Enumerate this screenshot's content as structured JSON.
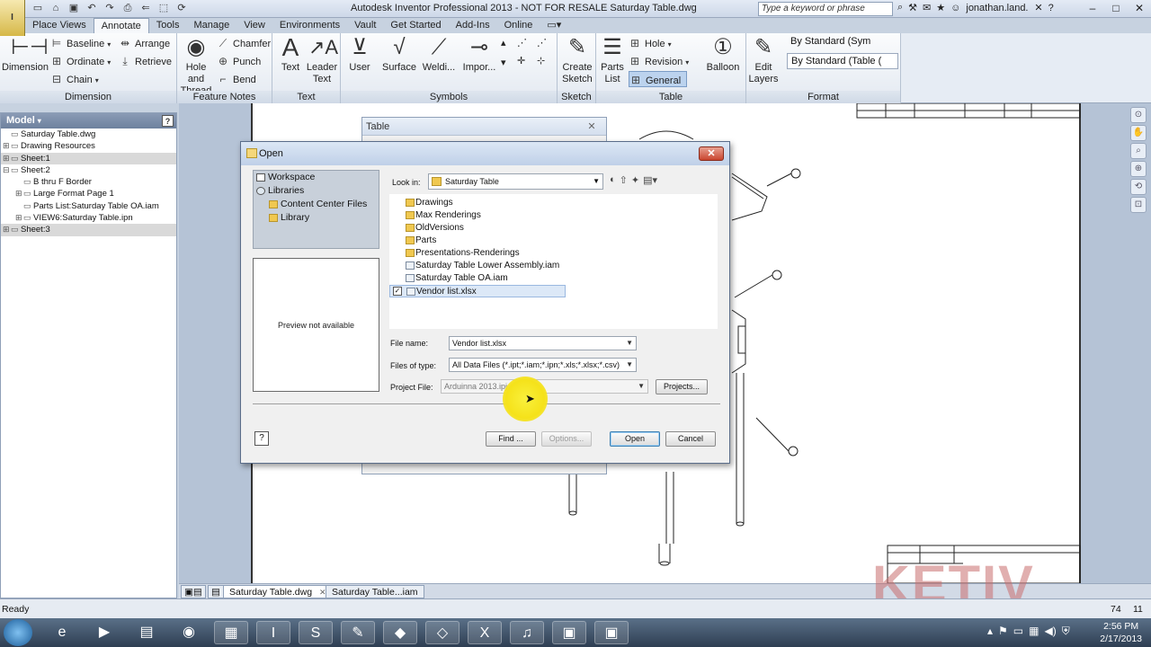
{
  "titlebar": {
    "app_logo": "I",
    "title": "Autodesk Inventor Professional 2013 - NOT FOR RESALE   Saturday Table.dwg",
    "search_placeholder": "Type a keyword or phrase",
    "user": "jonathan.land...",
    "qat_icons": [
      "new-icon",
      "open-icon",
      "save-icon",
      "undo-icon",
      "redo-icon",
      "print-icon",
      "return-icon",
      "select-icon",
      "update-icon"
    ]
  },
  "tabs": [
    "Place Views",
    "Annotate",
    "Tools",
    "Manage",
    "View",
    "Environments",
    "Vault",
    "Get Started",
    "Add-Ins",
    "Online"
  ],
  "ribbon": {
    "dimension": {
      "label": "Dimension",
      "big": "Dimension",
      "baseline": "Baseline",
      "ordinate": "Ordinate",
      "chain": "Chain",
      "arrange": "Arrange",
      "retrieve": "Retrieve"
    },
    "feature_notes": {
      "label": "Feature Notes",
      "hole_thread_1": "Hole and",
      "hole_thread_2": "Thread",
      "chamfer": "Chamfer",
      "punch": "Punch",
      "bend": "Bend"
    },
    "text": {
      "label": "Text",
      "text": "Text",
      "leader_1": "Leader",
      "leader_2": "Text"
    },
    "symbols": {
      "label": "Symbols",
      "user": "User",
      "surface": "Surface",
      "welding": "Weldi...",
      "import": "Impor..."
    },
    "sketch": {
      "label": "Sketch",
      "create_1": "Create",
      "create_2": "Sketch"
    },
    "table": {
      "label": "Table",
      "parts_1": "Parts",
      "parts_2": "List",
      "hole": "Hole",
      "revision": "Revision",
      "general": "General",
      "balloon": "Balloon"
    },
    "format": {
      "label": "Format",
      "edit_1": "Edit",
      "edit_2": "Layers",
      "combo1": "By Standard (Sym",
      "combo2": "By Standard (Table ("
    }
  },
  "browser": {
    "title": "Model",
    "items": [
      {
        "label": "Saturday Table.dwg",
        "level": 0,
        "exp": "",
        "sel": false
      },
      {
        "label": "Drawing Resources",
        "level": 0,
        "exp": "+",
        "sel": false
      },
      {
        "label": "Sheet:1",
        "level": 0,
        "exp": "+",
        "sel": true
      },
      {
        "label": "Sheet:2",
        "level": 0,
        "exp": "-",
        "sel": false
      },
      {
        "label": "B thru F Border",
        "level": 1,
        "exp": "",
        "sel": false
      },
      {
        "label": "Large Format Page 1",
        "level": 1,
        "exp": "+",
        "sel": false
      },
      {
        "label": "Parts List:Saturday Table OA.iam",
        "level": 1,
        "exp": "",
        "sel": false
      },
      {
        "label": "VIEW6:Saturday Table.ipn",
        "level": 1,
        "exp": "+",
        "sel": false
      },
      {
        "label": "Sheet:3",
        "level": 0,
        "exp": "+",
        "sel": true
      }
    ]
  },
  "table_dialog": {
    "title": "Table"
  },
  "open_dialog": {
    "title": "Open",
    "places": [
      {
        "label": "Workspace",
        "indent": false
      },
      {
        "label": "Libraries",
        "indent": false
      },
      {
        "label": "Content Center Files",
        "indent": true
      },
      {
        "label": "Library",
        "indent": true
      }
    ],
    "preview_text": "Preview not available",
    "look_in_label": "Look in:",
    "look_in_value": "Saturday Table",
    "files": [
      {
        "name": "Drawings",
        "type": "folder",
        "sel": false
      },
      {
        "name": "Max Renderings",
        "type": "folder",
        "sel": false
      },
      {
        "name": "OldVersions",
        "type": "folder",
        "sel": false
      },
      {
        "name": "Parts",
        "type": "folder",
        "sel": false
      },
      {
        "name": "Presentations-Renderings",
        "type": "folder",
        "sel": false
      },
      {
        "name": "Saturday Table Lower Assembly.iam",
        "type": "doc",
        "sel": false
      },
      {
        "name": "Saturday Table OA.iam",
        "type": "doc",
        "sel": false
      },
      {
        "name": "Vendor list.xlsx",
        "type": "doc",
        "sel": true
      }
    ],
    "file_name_label": "File name:",
    "file_name_value": "Vendor list.xlsx",
    "files_of_type_label": "Files of type:",
    "files_of_type_value": "All Data Files (*.ipt;*.iam;*.ipn;*.xls;*.xlsx;*.csv)",
    "project_file_label": "Project File:",
    "project_file_value": "Arduinna 2013.ipj",
    "projects_button": "Projects...",
    "find_button": "Find ...",
    "options_button": "Options...",
    "open_button": "Open",
    "cancel_button": "Cancel"
  },
  "doc_tabs": [
    {
      "label": "Saturday Table.dwg",
      "active": true
    },
    {
      "label": "Saturday Table...iam",
      "active": false
    }
  ],
  "status": {
    "text": "Ready",
    "n1": "74",
    "n2": "11"
  },
  "watermark": "KETIV",
  "taskbar": {
    "time": "2:56 PM",
    "date": "2/17/2013",
    "apps": [
      "ie-icon",
      "media-player-icon",
      "explorer-icon",
      "firefox-icon",
      "calculator-icon",
      "inventor-icon",
      "skype-icon",
      "notepad-icon",
      "inventor-tools-icon",
      "inventor-view-icon",
      "excel-icon",
      "headphones-icon",
      "inventor-task-icon",
      "inventor-task2-icon"
    ]
  }
}
